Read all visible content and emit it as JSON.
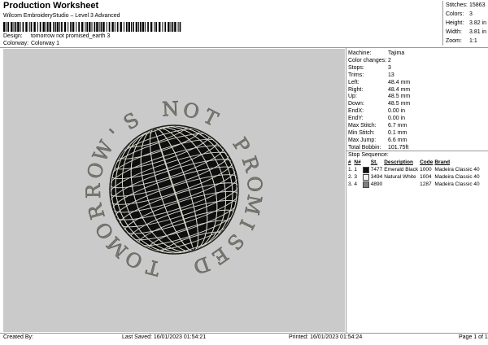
{
  "header": {
    "title": "Production Worksheet",
    "subtitle": "Wilcom EmbroideryStudio – Level 3 Advanced"
  },
  "design_info": {
    "design_label": "Design:",
    "design_value": "tomorrow not promised_earth 3",
    "colorway_label": "Colorway:",
    "colorway_value": "Colorway 1"
  },
  "stats": [
    {
      "label": "Stitches:",
      "value": "15863"
    },
    {
      "label": "Colors:",
      "value": "3"
    },
    {
      "label": "Height:",
      "value": "3.82 in"
    },
    {
      "label": "Width:",
      "value": "3.81 in"
    },
    {
      "label": "Zoom:",
      "value": "1:1"
    }
  ],
  "machine_info": [
    {
      "label": "Machine:",
      "value": "Tajima"
    },
    {
      "label": "Color changes:",
      "value": "2"
    },
    {
      "label": "Stops:",
      "value": "3"
    },
    {
      "label": "Trims:",
      "value": "13"
    },
    {
      "label": "Left:",
      "value": "48.4 mm"
    },
    {
      "label": "Right:",
      "value": "48.4 mm"
    },
    {
      "label": "Up:",
      "value": "48.5 mm"
    },
    {
      "label": "Down:",
      "value": "48.5 mm"
    },
    {
      "label": "EndX:",
      "value": "0.00 in"
    },
    {
      "label": "EndY:",
      "value": "0.00 in"
    },
    {
      "label": "Max Stitch:",
      "value": "6.7 mm"
    },
    {
      "label": "Min Stitch:",
      "value": "0.1 mm"
    },
    {
      "label": "Max Jump:",
      "value": "6.6 mm"
    },
    {
      "label": "Total Bobbin:",
      "value": "101.75ft"
    }
  ],
  "stop_sequence": {
    "title": "Stop Sequence:",
    "headers": [
      "#",
      "N#",
      "St.",
      "Description",
      "Code",
      "Brand"
    ],
    "rows": [
      {
        "num": "1.",
        "n": "1",
        "swatch": "#111111",
        "st": "7477",
        "description": "Emerald Black",
        "code": "1000",
        "brand": "Madeira Classic 40"
      },
      {
        "num": "2.",
        "n": "3",
        "swatch": "#f2f2f2",
        "st": "3494",
        "description": "Natural White",
        "code": "1004",
        "brand": "Madeira Classic 40"
      },
      {
        "num": "3.",
        "n": "4",
        "swatch": "#7f7f7f",
        "st": "4890",
        "description": "",
        "code": "1287",
        "brand": "Madeira Classic 40"
      }
    ]
  },
  "artwork": {
    "arc_text": "TOMORROW'S NOT PROMISED",
    "background": "#cacaca",
    "text_color": "#7a7a72",
    "globe_color": "#0f0f0f",
    "grid_color": "#d8d8cc"
  },
  "footer": {
    "created_by": "Created By:",
    "last_saved": "Last Saved: 16/01/2023 01:54:21",
    "printed": "Printed: 16/01/2023 01:54:24",
    "page": "Page 1 of 1"
  }
}
